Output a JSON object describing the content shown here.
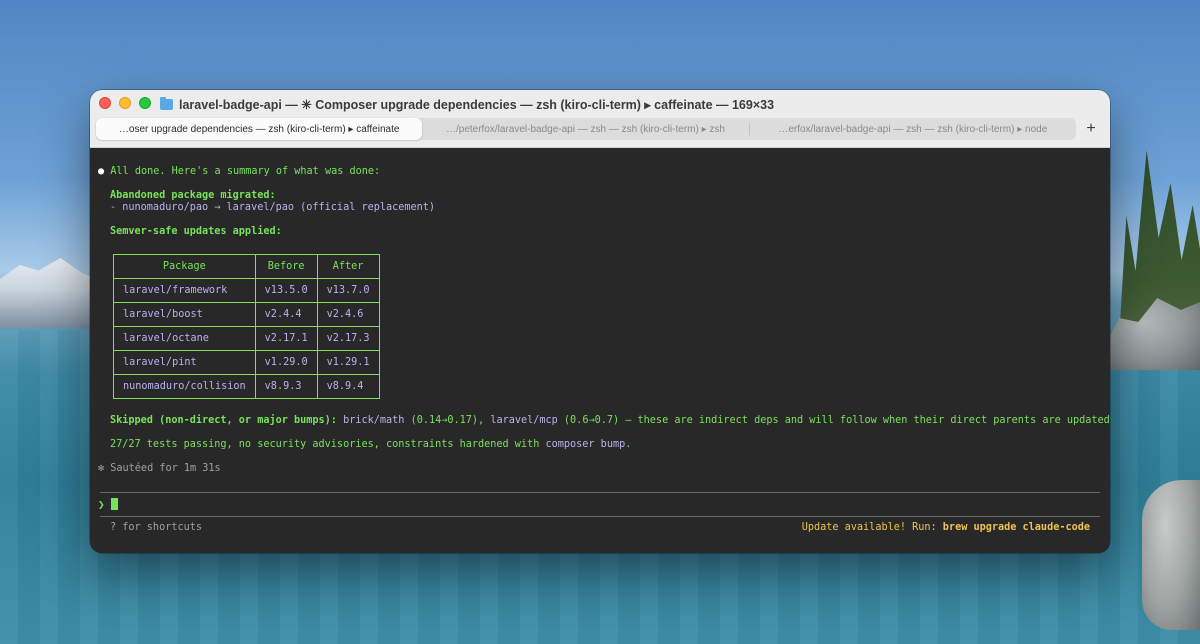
{
  "window": {
    "title": "laravel-badge-api — ✳ Composer upgrade dependencies — zsh (kiro-cli-term) ▸ caffeinate — 169×33",
    "tabs": [
      {
        "label": "…oser upgrade dependencies — zsh (kiro-cli-term) ▸ caffeinate",
        "active": true
      },
      {
        "label": "…/peterfox/laravel-badge-api — zsh — zsh (kiro-cli-term) ▸ zsh",
        "active": false
      },
      {
        "label": "…erfox/laravel-badge-api — zsh — zsh (kiro-cli-term) ▸ node",
        "active": false
      }
    ],
    "new_tab": "+"
  },
  "terminal": {
    "bullet": "●",
    "done": "All done. Here's a summary of what was done:",
    "abandoned_heading": "Abandoned package migrated:",
    "abandoned_item": "- nunomaduro/pao → laravel/pao (official replacement)",
    "semver_heading": "Semver-safe updates applied:",
    "table": {
      "headers": [
        "Package",
        "Before",
        "After"
      ],
      "rows": [
        [
          "laravel/framework",
          "v13.5.0",
          "v13.7.0"
        ],
        [
          "laravel/boost",
          "v2.4.4",
          "v2.4.6"
        ],
        [
          "laravel/octane",
          "v2.17.1",
          "v2.17.3"
        ],
        [
          "laravel/pint",
          "v1.29.0",
          "v1.29.1"
        ],
        [
          "nunomaduro/collision",
          "v8.9.3",
          "v8.9.4"
        ]
      ]
    },
    "skipped_label": "Skipped (non-direct, or major bumps):",
    "skipped_pkg1": "brick/math",
    "skipped_ver1": "(0.14→0.17),",
    "skipped_pkg2": "laravel/mcp",
    "skipped_ver2": "(0.6→0.7)",
    "skipped_rest": "— these are indirect deps and will follow when their direct parents are updated.",
    "tests_text": "27/27 tests passing, no security advisories, constraints hardened with",
    "tests_cmd": "composer bump",
    "tests_end": ".",
    "sauteed": "✻ Sautéed for 1m 31s",
    "prompt_symbol": "❯",
    "shortcuts": "? for shortcuts",
    "update_text": "Update available! Run: ",
    "update_cmd": "brew upgrade claude-code"
  }
}
